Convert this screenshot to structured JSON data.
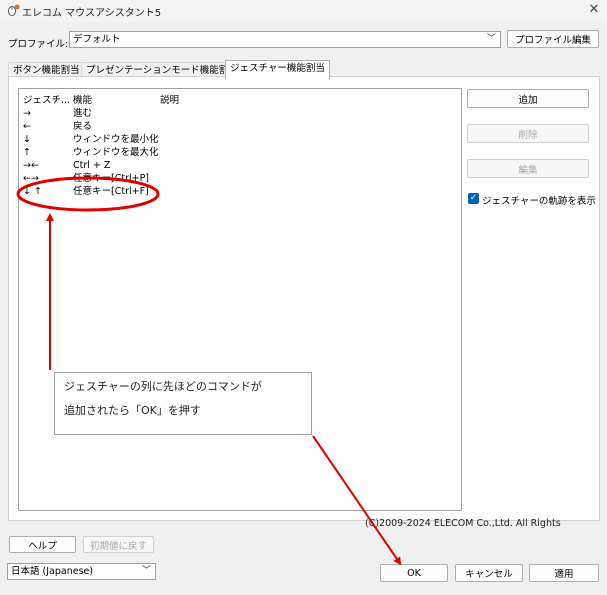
{
  "window": {
    "title": "エレコム マウスアシスタント5",
    "close_icon": "close-icon"
  },
  "profile": {
    "label": "プロファイル:",
    "selected": "デフォルト",
    "edit_button": "プロファイル編集"
  },
  "tabs": [
    {
      "label": "ボタン機能割当",
      "active": false
    },
    {
      "label": "プレゼンテーションモード機能割当",
      "active": false
    },
    {
      "label": "ジェスチャー機能割当",
      "active": true
    }
  ],
  "gesture_list": {
    "columns": [
      "ジェスチ...",
      "機能",
      "説明"
    ],
    "rows": [
      {
        "gesture": "→",
        "function": "進む",
        "description": ""
      },
      {
        "gesture": "←",
        "function": "戻る",
        "description": ""
      },
      {
        "gesture": "↓",
        "function": "ウィンドウを最小化",
        "description": ""
      },
      {
        "gesture": "↑",
        "function": "ウィンドウを最大化",
        "description": ""
      },
      {
        "gesture": "→←",
        "function": "Ctrl + Z",
        "description": ""
      },
      {
        "gesture": "←→",
        "function": "任意キー[Ctrl+P]",
        "description": ""
      },
      {
        "gesture": "↓ ↑",
        "function": "任意キー[Ctrl+F]",
        "description": ""
      }
    ]
  },
  "side_buttons": {
    "add": "追加",
    "delete": "削除",
    "edit": "編集",
    "show_trail_label": "ジェスチャーの軌跡を表示",
    "show_trail_checked": true
  },
  "annotation": {
    "line1": "ジェスチャーの列に先ほどのコマンドが",
    "line2": "追加されたら「OK」を押す",
    "color": "#e00000"
  },
  "copyright": "(C)2009-2024 ELECOM Co.,Ltd. All Rights",
  "footer": {
    "help": "ヘルプ",
    "reset": "初期値に戻す",
    "language": "日本語 (Japanese)",
    "ok": "OK",
    "cancel": "キャンセル",
    "apply": "適用"
  }
}
